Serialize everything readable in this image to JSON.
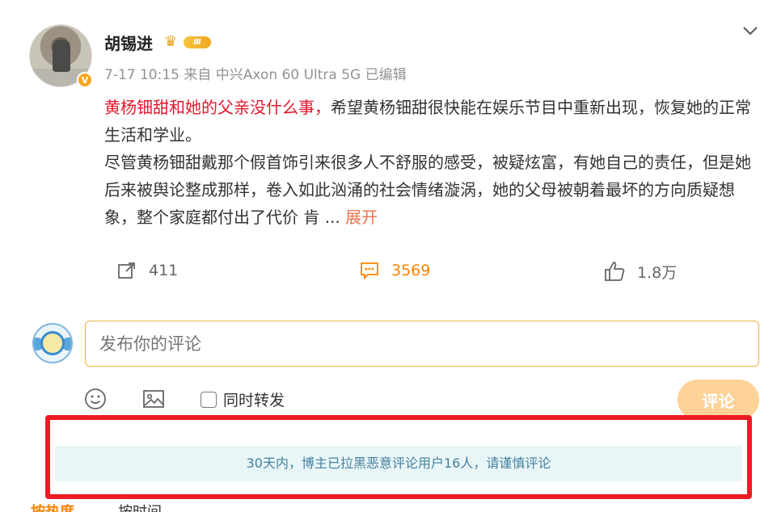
{
  "post": {
    "author": "胡锡进",
    "vip_level": "Ⅲ",
    "verified_mark": "V",
    "meta": "7-17 10:15 来自 中兴Axon 60 Ultra 5G 已编辑",
    "highlight": "黄杨钿甜和她的父亲没什么事，",
    "text_1": "希望黄杨钿甜很快能在娱乐节目中重新出现，恢复她的正常生活和学业。",
    "text_2": "尽管黄杨钿甜戴那个假首饰引来很多人不舒服的感受，被疑炫富，有她自己的责任，但是她后来被舆论整成那样，卷入如此汹涌的社会情绪漩涡，她的父母被朝着最坏的方向质疑想象，整个家庭都付出了代价",
    "truncated_tail": "肯 ...",
    "expand_label": "展开"
  },
  "actions": {
    "repost_count": "411",
    "comment_count": "3569",
    "like_count": "1.8万"
  },
  "composer": {
    "placeholder": "发布你的评论",
    "repost_label": "同时转发",
    "submit_label": "评论"
  },
  "notice": "30天内，博主已拉黑恶意评论用户16人，请谨慎评论",
  "sort": {
    "hot": "按热度",
    "time": "按时间"
  },
  "colors": {
    "highlight": "#e6162d",
    "accent": "#ff8200",
    "expand": "#eb7350",
    "notice_bg": "#e9f6f8",
    "frame": "#ec1c24"
  }
}
